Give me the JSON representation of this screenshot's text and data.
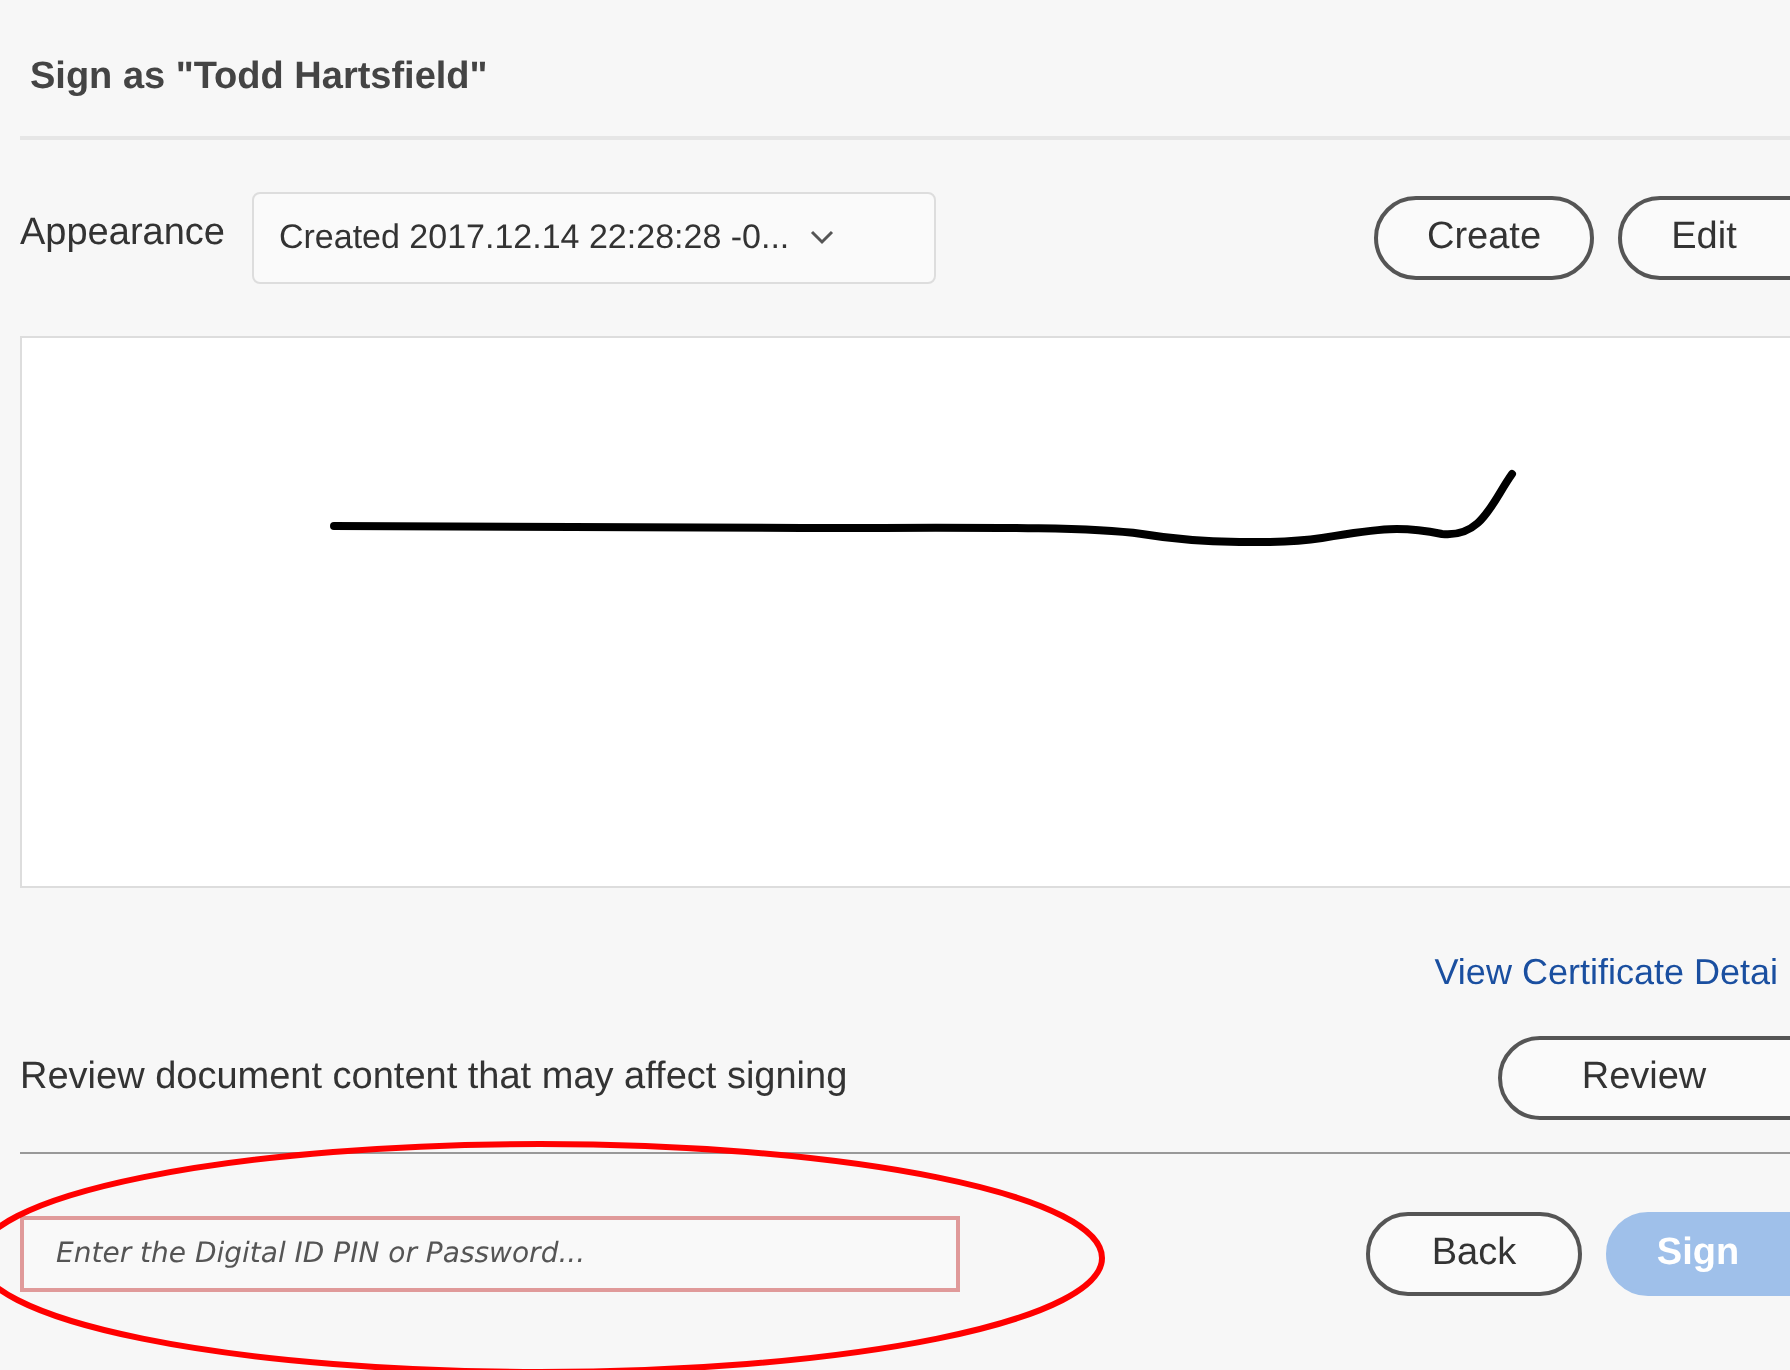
{
  "dialog": {
    "title": "Sign as \"Todd Hartsfield\""
  },
  "appearance": {
    "label": "Appearance",
    "value": "Created 2017.12.14 22:28:28 -0..."
  },
  "appearance_buttons": [
    {
      "label": "Create"
    },
    {
      "label": "Edit"
    }
  ],
  "certificate_link": "View Certificate Detai",
  "review": {
    "text": "Review document content that may affect signing",
    "button": "Review"
  },
  "pin_field": {
    "placeholder": "Enter the Digital ID PIN or Password..."
  },
  "footer_buttons": [
    {
      "label": "Back",
      "disabled": false
    },
    {
      "label": "Sign",
      "disabled": true
    }
  ],
  "annotation": {
    "kind": "ellipse",
    "color": "#ff0000"
  }
}
